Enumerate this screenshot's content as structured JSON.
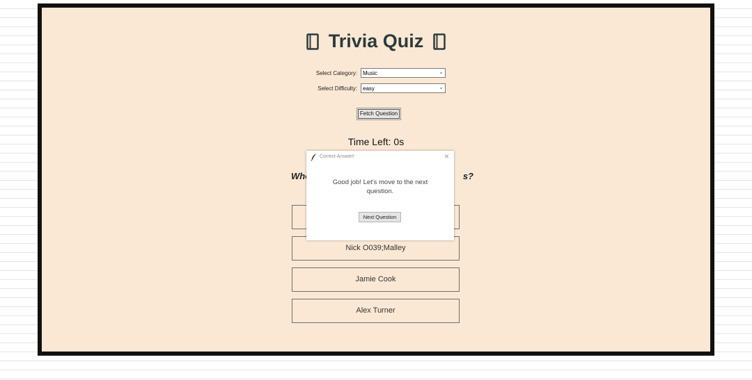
{
  "app": {
    "title": "Trivia Quiz",
    "icon": "notebook-icon"
  },
  "form": {
    "category_label": "Select Category:",
    "category_value": "Music",
    "difficulty_label": "Select Difficulty:",
    "difficulty_value": "easy",
    "fetch_label": "Fetch Question"
  },
  "timer": {
    "text": "Time Left: 0s"
  },
  "question": {
    "visible_start": "Who",
    "visible_end": "s?"
  },
  "answers": [
    {
      "label": ""
    },
    {
      "label": "Nick O039;Malley"
    },
    {
      "label": "Jamie Cook"
    },
    {
      "label": "Alex Turner"
    }
  ],
  "dialog": {
    "title": "Correct Answer!",
    "message": "Good job! Let's move to the next question.",
    "button_label": "Next Question",
    "icon": "feather-icon"
  },
  "colors": {
    "app_background": "#fbe8d4",
    "title_color": "#2c3b3d",
    "frame_border": "#111111"
  }
}
